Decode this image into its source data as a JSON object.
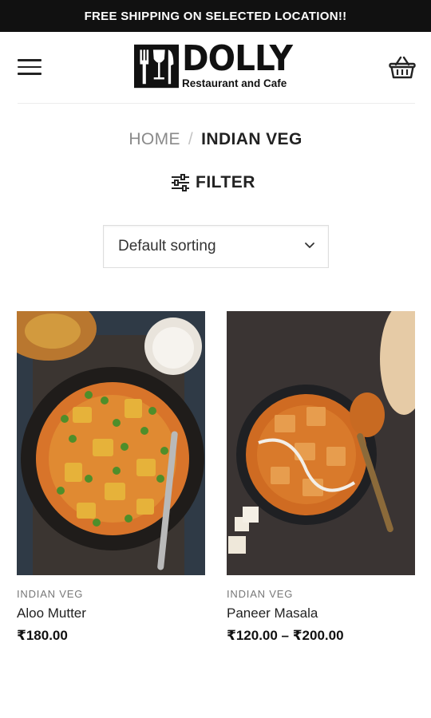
{
  "announcement": {
    "text": "FREE SHIPPING ON SELECTED LOCATION!!"
  },
  "header": {
    "logo_title": "DOLLY",
    "logo_subtitle": "Restaurant and Cafe",
    "menu_icon": "hamburger-menu-icon",
    "cart_icon": "basket-icon"
  },
  "breadcrumb": {
    "home": "HOME",
    "separator": "/",
    "current": "INDIAN VEG"
  },
  "filter": {
    "label": "FILTER",
    "icon": "sliders-icon"
  },
  "sorting": {
    "selected": "Default sorting"
  },
  "products": [
    {
      "category": "INDIAN VEG",
      "name": "Aloo Mutter",
      "price": "₹180.00"
    },
    {
      "category": "INDIAN VEG",
      "name": "Paneer Masala",
      "price": "₹120.00 – ₹200.00"
    }
  ],
  "colors": {
    "topbar_bg": "#111111",
    "text_dark": "#222222",
    "text_muted": "#8a8a8a",
    "border": "#dedede"
  }
}
